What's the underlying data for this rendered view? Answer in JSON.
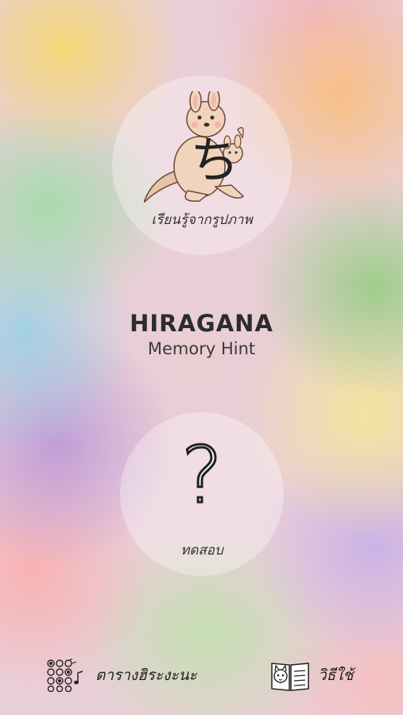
{
  "app": {
    "title": "HIRAGANA",
    "subtitle": "Memory Hint"
  },
  "learn_button": {
    "label": "เรียนรู้จากรูปภาพ",
    "glyph": "ち",
    "icon": "kangaroo-illustration"
  },
  "quiz_button": {
    "label": "ทดสอบ",
    "glyph": "?"
  },
  "bottom_bar": {
    "chart_label": "ตารางฮิระงะนะ",
    "chart_icon": "dot-grid-music-icon",
    "howto_label": "วิธีใช้",
    "howto_icon": "book-cat-icon"
  }
}
